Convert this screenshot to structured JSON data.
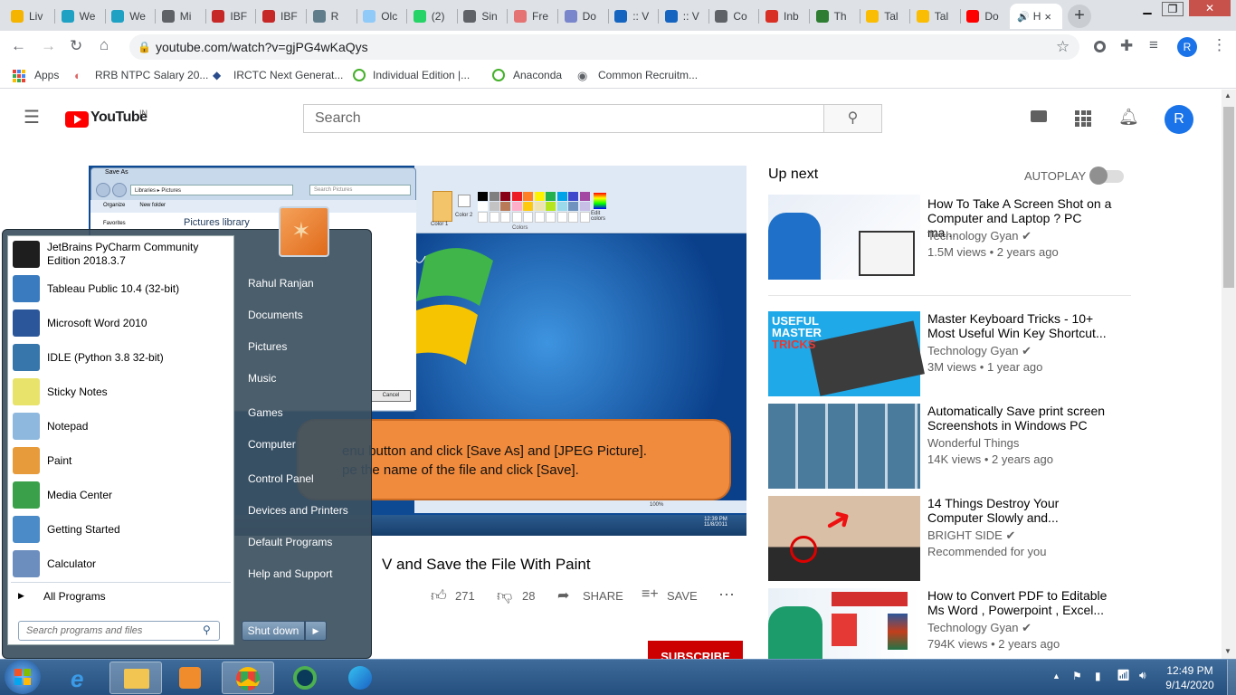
{
  "browser": {
    "tabs": [
      {
        "title": "Liv",
        "color": "#f4b400"
      },
      {
        "title": "We",
        "color": "#1fa1c4"
      },
      {
        "title": "We",
        "color": "#1fa1c4"
      },
      {
        "title": "Mi",
        "color": "#5f6368"
      },
      {
        "title": "IBF",
        "color": "#c62828"
      },
      {
        "title": "IBF",
        "color": "#c62828"
      },
      {
        "title": "R",
        "color": "#607d8b"
      },
      {
        "title": "Olc",
        "color": "#90caf9"
      },
      {
        "title": "(2)",
        "color": "#25d366"
      },
      {
        "title": "Sin",
        "color": "#5f6368"
      },
      {
        "title": "Fre",
        "color": "#e57373"
      },
      {
        "title": "Do",
        "color": "#7986cb"
      },
      {
        "title": ":: V",
        "color": "#1565c0"
      },
      {
        "title": ":: V",
        "color": "#1565c0"
      },
      {
        "title": "Co",
        "color": "#5f6368"
      },
      {
        "title": "Inb",
        "color": "#d93025"
      },
      {
        "title": "Th",
        "color": "#2e7d32"
      },
      {
        "title": "Tal",
        "color": "#fbbc04"
      },
      {
        "title": "Tal",
        "color": "#fbbc04"
      },
      {
        "title": "Do",
        "color": "#ff0000"
      }
    ],
    "active_tab": {
      "title": "H",
      "close": "×"
    },
    "new_tab": "+",
    "url": "youtube.com/watch?v=gjPG4wKaQys",
    "profile_initial": "R",
    "bookmarks": [
      "Apps",
      "RRB NTPC Salary 20...",
      "IRCTC Next Generat...",
      "Individual Edition |...",
      "Anaconda",
      "Common Recruitm..."
    ]
  },
  "youtube": {
    "logo": "YouTube",
    "region": "IN",
    "search_placeholder": "Search",
    "avatar": "R",
    "up_next": "Up next",
    "autoplay": "AUTOPLAY",
    "video_title_visible": "V and Save the File With Paint",
    "likes": "271",
    "dislikes": "28",
    "share": "SHARE",
    "save": "SAVE",
    "subscribe": "SUBSCRIBE",
    "video_caption_line1": "enu button and click [Save As] and [JPEG Picture].",
    "video_caption_line2": "pe the name of the file and click [Save].",
    "recommendations": [
      {
        "title": "How To Take A Screen Shot on a Computer and Laptop ? PC ma...",
        "channel": "Technology Gyan",
        "verified": true,
        "meta": "1.5M views • 2 years ago"
      },
      {
        "title": "Master Keyboard Tricks - 10+ Most Useful Win Key Shortcut...",
        "channel": "Technology Gyan",
        "verified": true,
        "meta": "3M views • 1 year ago"
      },
      {
        "title": "Automatically Save print screen Screenshots in Windows PC",
        "channel": "Wonderful Things",
        "verified": false,
        "meta": "14K views • 2 years ago"
      },
      {
        "title": "14 Things Destroy Your Computer Slowly and...",
        "channel": "BRIGHT SIDE",
        "verified": true,
        "meta": "Recommended for you"
      },
      {
        "title": "How to Convert PDF to Editable Ms Word , Powerpoint , Excel...",
        "channel": "Technology Gyan",
        "verified": true,
        "meta": "794K views • 2 years ago"
      }
    ]
  },
  "embedded_video": {
    "dialog_title": "Save As",
    "breadcrumb": "Libraries ▸ Pictures",
    "search_label": "Search Pictures",
    "organize": "Organize",
    "new_folder": "New folder",
    "favorites": "Favorites",
    "library": "Pictures library",
    "cancel": "Cancel",
    "color1": "Color 1",
    "color2": "Color 2",
    "edit_colors": "Edit colors",
    "colors_group": "Colors",
    "zoom": "100%",
    "clock_time": "12:39 PM",
    "clock_date": "11/8/2011"
  },
  "start_menu": {
    "programs": [
      {
        "name": "JetBrains PyCharm Community Edition 2018.3.7",
        "color": "#1e1e1e"
      },
      {
        "name": "Tableau Public 10.4 (32-bit)",
        "color": "#3a7bbf"
      },
      {
        "name": "Microsoft Word 2010",
        "color": "#2b579a"
      },
      {
        "name": "IDLE (Python 3.8 32-bit)",
        "color": "#3776ab"
      },
      {
        "name": "Sticky Notes",
        "color": "#e8e36a"
      },
      {
        "name": "Notepad",
        "color": "#8fb8de"
      },
      {
        "name": "Paint",
        "color": "#e89b3a"
      },
      {
        "name": "Media Center",
        "color": "#3aa14a"
      },
      {
        "name": "Getting Started",
        "color": "#4b8bc7"
      },
      {
        "name": "Calculator",
        "color": "#6c8ebf"
      }
    ],
    "all_programs": "All Programs",
    "search_placeholder": "Search programs and files",
    "places": [
      "Rahul Ranjan",
      "Documents",
      "Pictures",
      "Music",
      "Games",
      "Computer",
      "Control Panel",
      "Devices and Printers",
      "Default Programs",
      "Help and Support"
    ],
    "shutdown": "Shut down"
  },
  "taskbar": {
    "time": "12:49 PM",
    "date": "9/14/2020"
  }
}
